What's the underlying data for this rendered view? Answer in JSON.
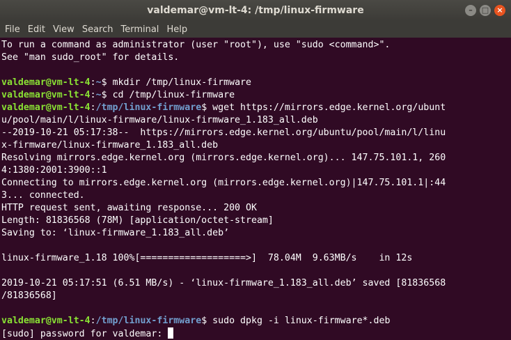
{
  "window": {
    "title": "valdemar@vm-lt-4: /tmp/linux-firmware",
    "minimize": "–",
    "maximize": "□",
    "close": "×"
  },
  "menu": {
    "file": "File",
    "edit": "Edit",
    "view": "View",
    "search": "Search",
    "terminal": "Terminal",
    "help": "Help"
  },
  "colors": {
    "background": "#300a24",
    "prompt_user": "#8ae234",
    "prompt_path": "#729fcf",
    "close_button": "#e95420"
  },
  "terminal": {
    "lines": [
      {
        "text": "To run a command as administrator (user \"root\"), use \"sudo <command>\"."
      },
      {
        "text": "See \"man sudo_root\" for details."
      },
      {
        "text": ""
      },
      {
        "user": "valdemar@vm-lt-4",
        "sep": ":",
        "path": "~",
        "symbol": "$ ",
        "text": "mkdir /tmp/linux-firmware"
      },
      {
        "user": "valdemar@vm-lt-4",
        "sep": ":",
        "path": "~",
        "symbol": "$ ",
        "text": "cd /tmp/linux-firmware"
      },
      {
        "user": "valdemar@vm-lt-4",
        "sep": ":",
        "path": "/tmp/linux-firmware",
        "symbol": "$ ",
        "text": "wget https://mirrors.edge.kernel.org/ubunt"
      },
      {
        "text": "u/pool/main/l/linux-firmware/linux-firmware_1.183_all.deb"
      },
      {
        "text": "--2019-10-21 05:17:38--  https://mirrors.edge.kernel.org/ubuntu/pool/main/l/linu"
      },
      {
        "text": "x-firmware/linux-firmware_1.183_all.deb"
      },
      {
        "text": "Resolving mirrors.edge.kernel.org (mirrors.edge.kernel.org)... 147.75.101.1, 260"
      },
      {
        "text": "4:1380:2001:3900::1"
      },
      {
        "text": "Connecting to mirrors.edge.kernel.org (mirrors.edge.kernel.org)|147.75.101.1|:44"
      },
      {
        "text": "3... connected."
      },
      {
        "text": "HTTP request sent, awaiting response... 200 OK"
      },
      {
        "text": "Length: 81836568 (78M) [application/octet-stream]"
      },
      {
        "text": "Saving to: ‘linux-firmware_1.183_all.deb’"
      },
      {
        "text": ""
      },
      {
        "text": "linux-firmware_1.18 100%[===================>]  78.04M  9.63MB/s    in 12s"
      },
      {
        "text": ""
      },
      {
        "text": "2019-10-21 05:17:51 (6.51 MB/s) - ‘linux-firmware_1.183_all.deb’ saved [81836568"
      },
      {
        "text": "/81836568]"
      },
      {
        "text": ""
      },
      {
        "user": "valdemar@vm-lt-4",
        "sep": ":",
        "path": "/tmp/linux-firmware",
        "symbol": "$ ",
        "text": "sudo dpkg -i linux-firmware*.deb"
      },
      {
        "text": "[sudo] password for valdemar: "
      }
    ]
  }
}
